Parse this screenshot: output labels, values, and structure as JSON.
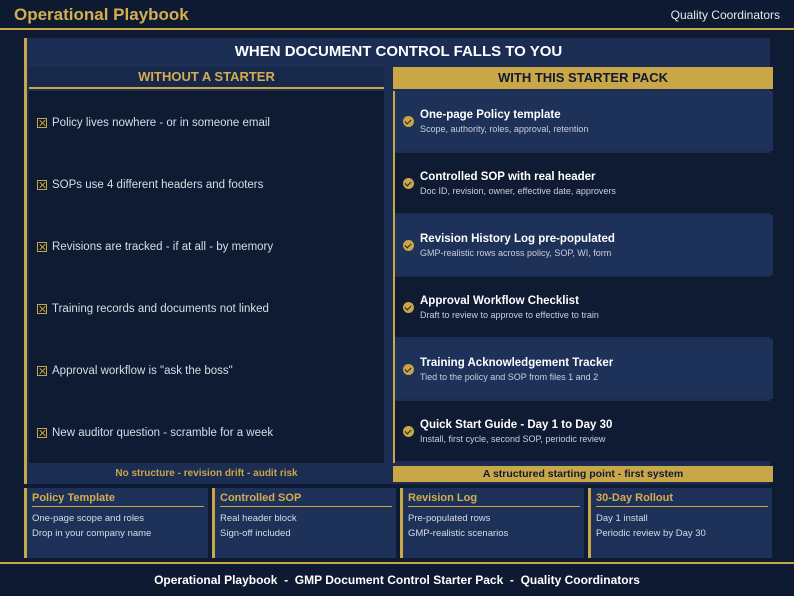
{
  "header": {
    "brand": "Operational Playbook",
    "audience": "Quality Coordinators"
  },
  "banner": "WHEN DOCUMENT CONTROL FALLS TO YOU",
  "left": {
    "heading": "WITHOUT A STARTER",
    "items": [
      "Policy lives nowhere - or in someone email",
      "SOPs use 4 different headers and footers",
      "Revisions are tracked - if at all - by memory",
      "Training records and documents not linked",
      "Approval workflow is \"ask the boss\"",
      "New auditor question - scramble for a week"
    ],
    "footer": "No structure - revision drift - audit risk"
  },
  "right": {
    "heading": "WITH THIS STARTER PACK",
    "items": [
      {
        "title": "One-page Policy template",
        "sub": "Scope, authority, roles, approval, retention"
      },
      {
        "title": "Controlled SOP with real header",
        "sub": "Doc ID, revision, owner, effective date, approvers"
      },
      {
        "title": "Revision History Log pre-populated",
        "sub": "GMP-realistic rows across policy, SOP, WI, form"
      },
      {
        "title": "Approval Workflow Checklist",
        "sub": "Draft to review to approve to effective to train"
      },
      {
        "title": "Training Acknowledgement Tracker",
        "sub": "Tied to the policy and SOP from files 1 and 2"
      },
      {
        "title": "Quick Start Guide - Day 1 to Day 30",
        "sub": "Install, first cycle, second SOP, periodic review"
      }
    ],
    "footer": "A structured starting point - first system"
  },
  "cards": [
    {
      "title": "Policy Template",
      "lines": [
        "One-page scope and roles",
        "Drop in your company name"
      ]
    },
    {
      "title": "Controlled SOP",
      "lines": [
        "Real header block",
        "Sign-off included"
      ]
    },
    {
      "title": "Revision Log",
      "lines": [
        "Pre-populated rows",
        "GMP-realistic scenarios"
      ]
    },
    {
      "title": "30-Day Rollout",
      "lines": [
        "Day 1 install",
        "Periodic review by Day 30"
      ]
    }
  ],
  "footer": "Operational Playbook  -  GMP Document Control Starter Pack  -  Quality Coordinators",
  "colors": {
    "gold": "#c9a646",
    "navy": "#0f1b33",
    "panel": "#1b2d52"
  },
  "icons": {
    "left_item": "x-box-icon",
    "right_item": "check-circle-icon"
  }
}
